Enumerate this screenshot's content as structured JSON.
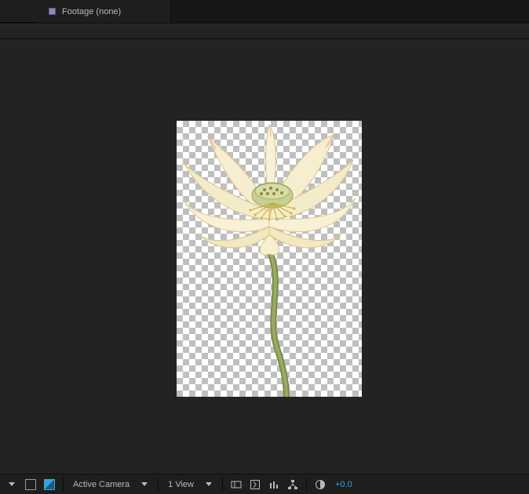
{
  "tabs": {
    "footage": {
      "label": "Footage (none)"
    }
  },
  "footer": {
    "camera_label": "Active Camera",
    "view_label": "1 View",
    "exposure": "+0.0"
  },
  "colors": {
    "accent_blue": "#3aa0e8",
    "swatch_purple": "#8f88c0"
  }
}
